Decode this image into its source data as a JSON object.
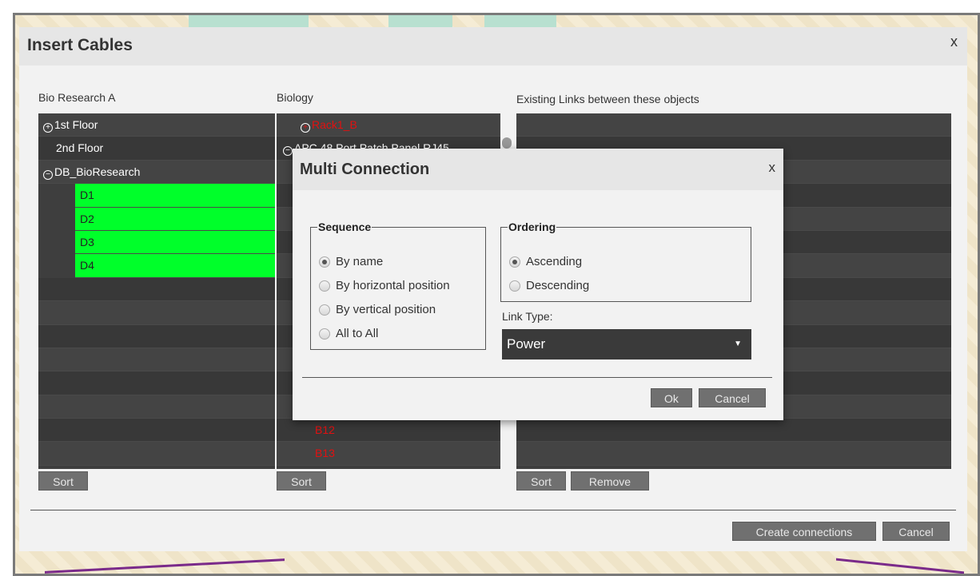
{
  "dialog": {
    "title": "Insert Cables",
    "close": "x",
    "create_label": "Create connections",
    "cancel_label": "Cancel"
  },
  "left_panel": {
    "label": "Bio Research A",
    "sort_label": "Sort",
    "rows": [
      {
        "text": "1st Floor",
        "expander": "+",
        "indent": 6,
        "style": "normal"
      },
      {
        "text": "2nd Floor",
        "expander": "",
        "indent": 22,
        "style": "normal"
      },
      {
        "text": "DB_BioResearch",
        "expander": "−",
        "indent": 6,
        "style": "normal"
      },
      {
        "text": "D1",
        "expander": "",
        "indent": 52,
        "style": "green"
      },
      {
        "text": "D2",
        "expander": "",
        "indent": 52,
        "style": "green"
      },
      {
        "text": "D3",
        "expander": "",
        "indent": 52,
        "style": "green"
      },
      {
        "text": "D4",
        "expander": "",
        "indent": 52,
        "style": "green"
      },
      {
        "text": "",
        "expander": "",
        "indent": 0,
        "style": "normal"
      },
      {
        "text": "",
        "expander": "",
        "indent": 0,
        "style": "normal"
      },
      {
        "text": "",
        "expander": "",
        "indent": 0,
        "style": "normal"
      },
      {
        "text": "",
        "expander": "",
        "indent": 0,
        "style": "normal"
      },
      {
        "text": "",
        "expander": "",
        "indent": 0,
        "style": "normal"
      },
      {
        "text": "",
        "expander": "",
        "indent": 0,
        "style": "normal"
      },
      {
        "text": "",
        "expander": "",
        "indent": 0,
        "style": "normal"
      },
      {
        "text": "",
        "expander": "",
        "indent": 0,
        "style": "normal"
      }
    ]
  },
  "middle_panel": {
    "label": "Biology",
    "sort_label": "Sort",
    "rows": [
      {
        "text": "Rack1_B",
        "expander": "+",
        "indent": 30,
        "style": "red"
      },
      {
        "text": "APC 48 Port Patch Panel RJ45",
        "expander": "−",
        "indent": 8,
        "style": "normal"
      },
      {
        "text": "",
        "expander": "",
        "indent": 0,
        "style": "normal"
      },
      {
        "text": "",
        "expander": "",
        "indent": 0,
        "style": "normal"
      },
      {
        "text": "",
        "expander": "",
        "indent": 0,
        "style": "normal"
      },
      {
        "text": "",
        "expander": "",
        "indent": 0,
        "style": "normal"
      },
      {
        "text": "",
        "expander": "",
        "indent": 0,
        "style": "normal"
      },
      {
        "text": "",
        "expander": "",
        "indent": 0,
        "style": "normal"
      },
      {
        "text": "",
        "expander": "",
        "indent": 0,
        "style": "normal"
      },
      {
        "text": "",
        "expander": "",
        "indent": 0,
        "style": "normal"
      },
      {
        "text": "",
        "expander": "",
        "indent": 0,
        "style": "normal"
      },
      {
        "text": "",
        "expander": "",
        "indent": 0,
        "style": "normal"
      },
      {
        "text": "",
        "expander": "",
        "indent": 0,
        "style": "normal"
      },
      {
        "text": "B12",
        "expander": "",
        "indent": 48,
        "style": "red"
      },
      {
        "text": "B13",
        "expander": "",
        "indent": 48,
        "style": "red"
      }
    ]
  },
  "right_panel": {
    "label": "Existing Links between these objects",
    "sort_label": "Sort",
    "remove_label": "Remove",
    "row_count": 15
  },
  "modal": {
    "title": "Multi Connection",
    "close": "x",
    "sequence": {
      "legend": "Sequence",
      "options": [
        "By name",
        "By horizontal position",
        "By vertical position",
        "All to All"
      ],
      "selected": "By name"
    },
    "ordering": {
      "legend": "Ordering",
      "options": [
        "Ascending",
        "Descending"
      ],
      "selected": "Ascending"
    },
    "link_type_label": "Link Type:",
    "link_type_value": "Power",
    "ok_label": "Ok",
    "cancel_label": "Cancel"
  },
  "colors": {
    "selected_row": "#00ff2a",
    "panel_bg": "#3e3e3e",
    "red_text": "#e21010",
    "button_bg": "#707070"
  }
}
